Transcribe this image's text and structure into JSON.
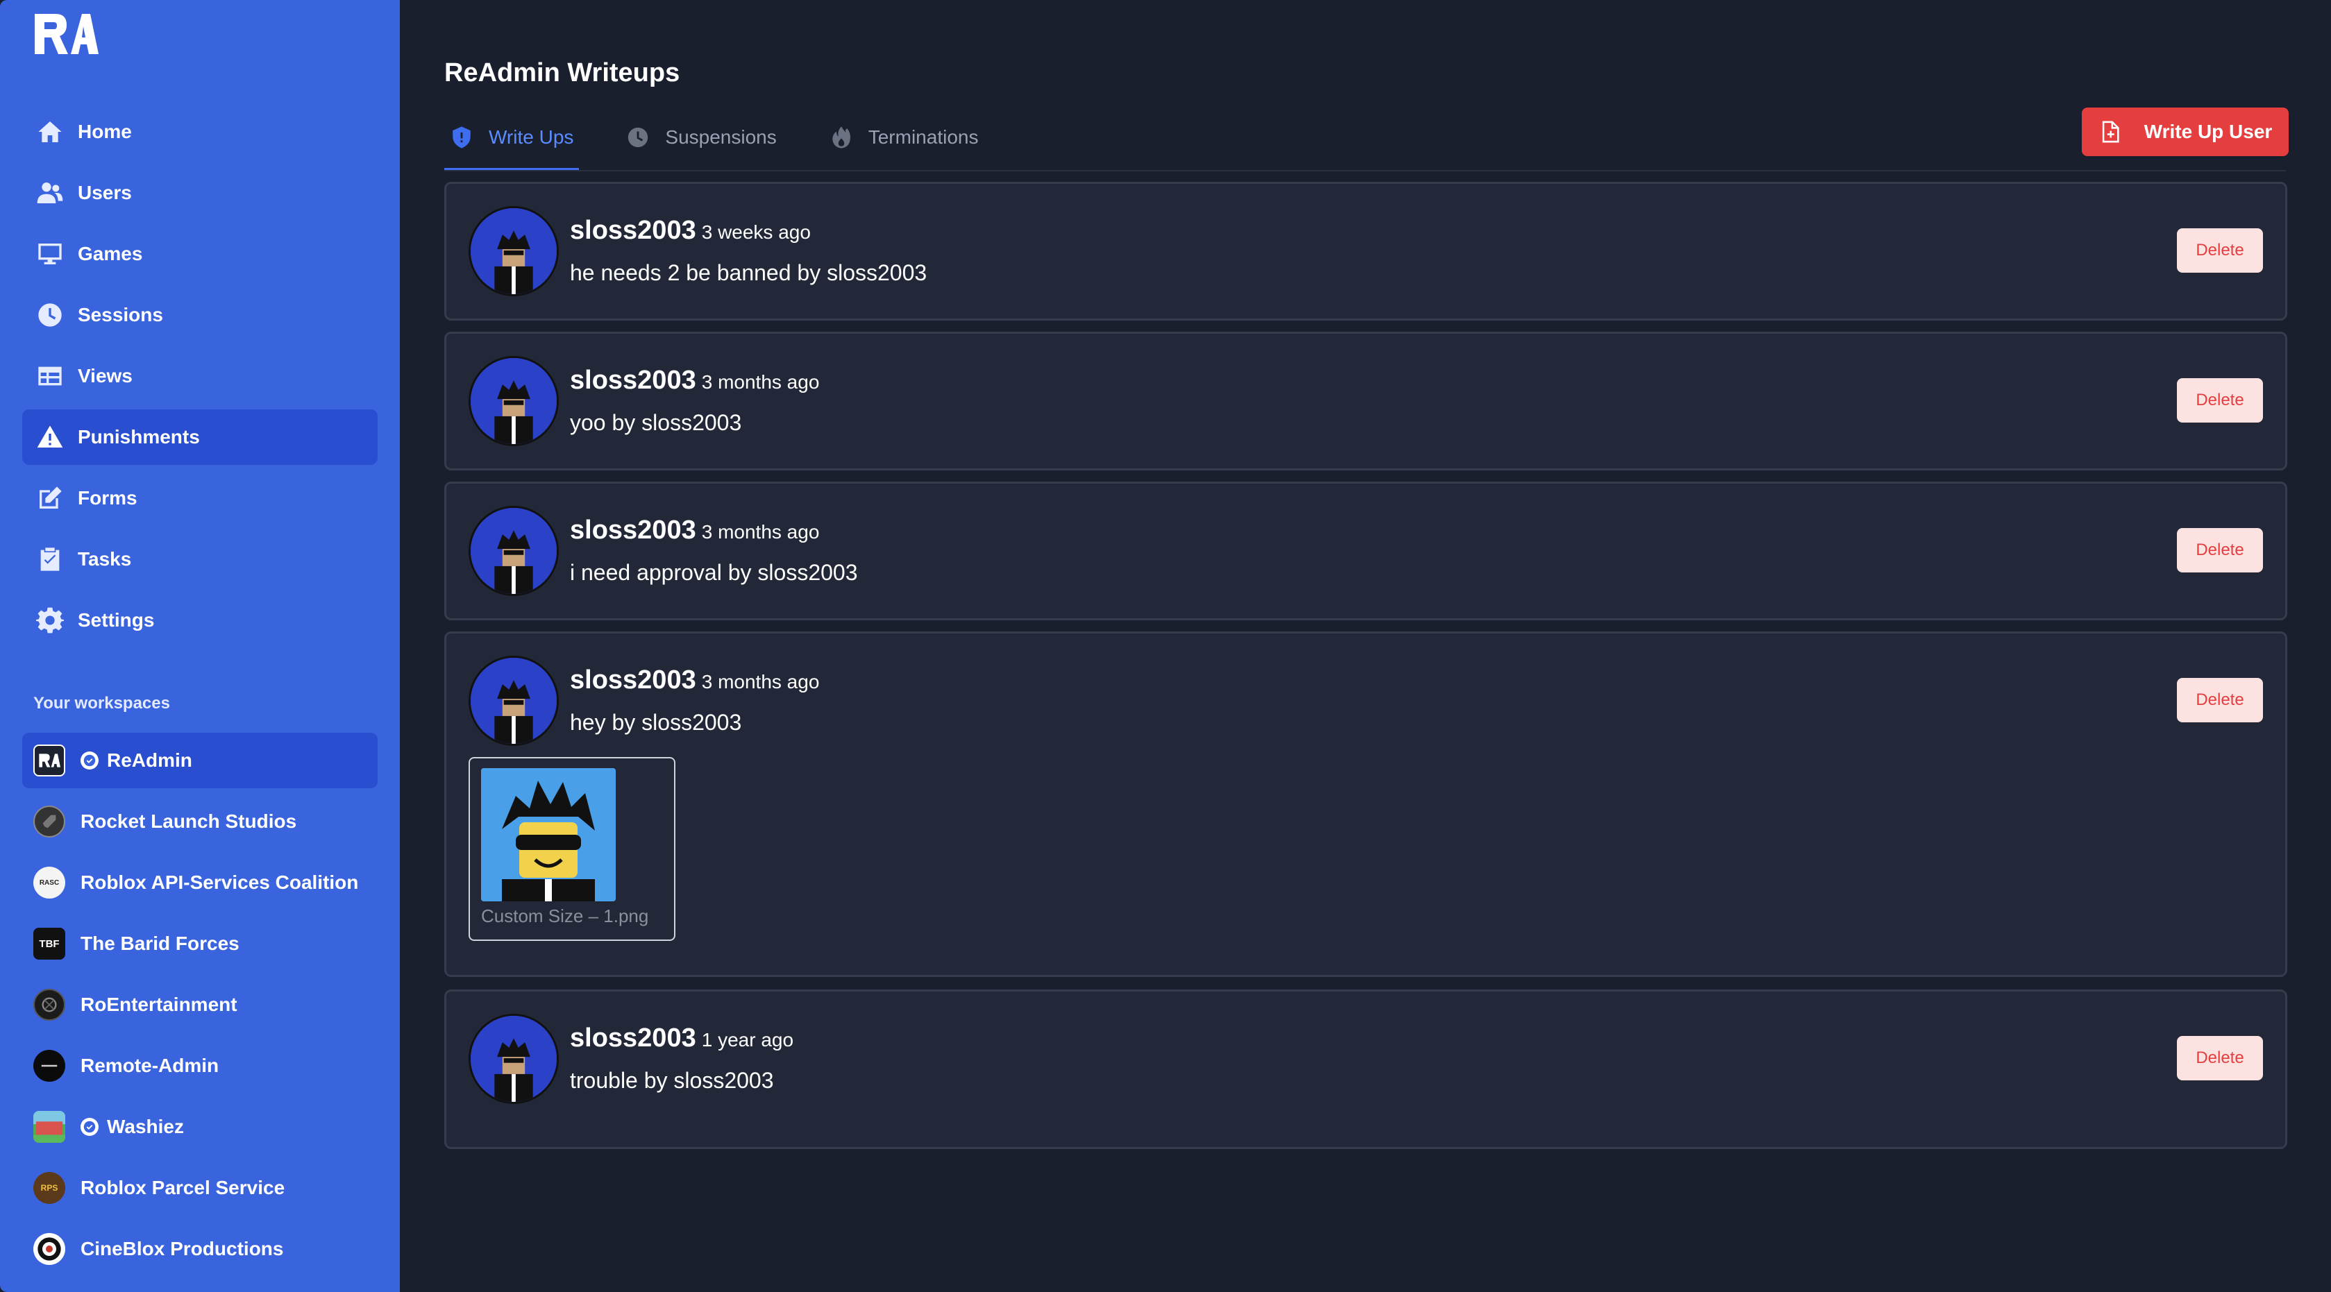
{
  "sidebar": {
    "logo_text": "RA",
    "nav": [
      {
        "label": "Home",
        "icon": "home-icon"
      },
      {
        "label": "Users",
        "icon": "users-icon"
      },
      {
        "label": "Games",
        "icon": "monitor-icon"
      },
      {
        "label": "Sessions",
        "icon": "clock-icon"
      },
      {
        "label": "Views",
        "icon": "table-icon"
      },
      {
        "label": "Punishments",
        "icon": "warning-icon",
        "active": true
      },
      {
        "label": "Forms",
        "icon": "pencil-square-icon"
      },
      {
        "label": "Tasks",
        "icon": "clipboard-icon"
      },
      {
        "label": "Settings",
        "icon": "gear-icon"
      }
    ],
    "workspaces_heading": "Your workspaces",
    "workspaces": [
      {
        "label": "ReAdmin",
        "icon_text": "RA",
        "verified": true,
        "active": true
      },
      {
        "label": "Rocket Launch Studios",
        "icon_text": ""
      },
      {
        "label": "Roblox API-Services Coalition",
        "icon_text": "RASC"
      },
      {
        "label": "The Barid Forces",
        "icon_text": "TBF"
      },
      {
        "label": "RoEntertainment",
        "icon_text": ""
      },
      {
        "label": "Remote-Admin",
        "icon_text": ""
      },
      {
        "label": "Washiez",
        "icon_text": "",
        "verified": true
      },
      {
        "label": "Roblox Parcel Service",
        "icon_text": "RPS"
      },
      {
        "label": "CineBlox Productions",
        "icon_text": ""
      }
    ]
  },
  "main": {
    "title": "ReAdmin Writeups",
    "tabs": [
      {
        "label": "Write Ups",
        "icon": "shield-icon",
        "active": true
      },
      {
        "label": "Suspensions",
        "icon": "clock-icon"
      },
      {
        "label": "Terminations",
        "icon": "fire-icon"
      }
    ],
    "write_up_button": "Write Up User",
    "delete_label": "Delete",
    "writeups": [
      {
        "user": "sloss2003",
        "time": "3 weeks ago",
        "text": "he needs 2 be banned by sloss2003"
      },
      {
        "user": "sloss2003",
        "time": "3 months ago",
        "text": "yoo by sloss2003"
      },
      {
        "user": "sloss2003",
        "time": "3 months ago",
        "text": "i need approval by sloss2003"
      },
      {
        "user": "sloss2003",
        "time": "3 months ago",
        "text": "hey by sloss2003",
        "attachment": "Custom Size – 1.png"
      },
      {
        "user": "sloss2003",
        "time": "1 year ago",
        "text": "trouble by sloss2003"
      }
    ]
  },
  "colors": {
    "sidebar_bg": "#3a63de",
    "sidebar_active": "#2a4ed0",
    "main_bg": "#1a1f2e",
    "card_bg": "#232838",
    "accent": "#3e6df0",
    "danger": "#e53e3e"
  }
}
